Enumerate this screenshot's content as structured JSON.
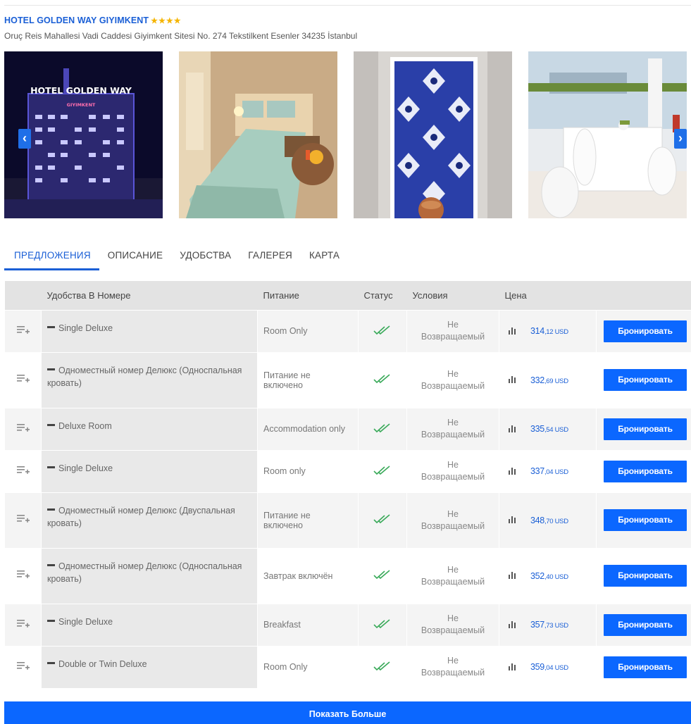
{
  "hotel": {
    "name": "HOTEL GOLDEN WAY GIYIMKENT",
    "stars": "★★★★",
    "address": "Oruç Reis Mahallesi Vadi Caddesi Giyimkent Sitesi No. 274 Tekstilkent Esenler 34235 İstanbul"
  },
  "gallery": {
    "sign_text": "HOTEL GOLDEN WAY",
    "sign_sub": "GIYIMKENT",
    "prev_arrow": "‹",
    "next_arrow": "›",
    "photos": [
      "hotel-exterior-night",
      "bedroom",
      "tile-panel",
      "banquet-hall"
    ]
  },
  "tabs": [
    "ПРЕДЛОЖЕНИЯ",
    "ОПИСАНИЕ",
    "УДОБСТВА",
    "ГАЛЕРЕЯ",
    "КАРТА"
  ],
  "table": {
    "headers": {
      "room": "Удобства В Номере",
      "meal": "Питание",
      "status": "Статус",
      "conditions": "Условия",
      "price": "Цена"
    },
    "rows": [
      {
        "room": "Single Deluxe",
        "meal": "Room Only",
        "cond1": "Не",
        "cond2": "Возвращаемый",
        "price_int": "314",
        "price_dec": ",12 USD",
        "book": "Бронировать"
      },
      {
        "room": "Одноместный номер Делюкс (Односпальная кровать)",
        "meal": "Питание не включено",
        "cond1": "Не",
        "cond2": "Возвращаемый",
        "price_int": "332",
        "price_dec": ",69 USD",
        "book": "Бронировать"
      },
      {
        "room": "Deluxe Room",
        "meal": "Accommodation only",
        "cond1": "Не",
        "cond2": "Возвращаемый",
        "price_int": "335",
        "price_dec": ",54 USD",
        "book": "Бронировать"
      },
      {
        "room": "Single Deluxe",
        "meal": "Room only",
        "cond1": "Не",
        "cond2": "Возвращаемый",
        "price_int": "337",
        "price_dec": ",04 USD",
        "book": "Бронировать"
      },
      {
        "room": "Одноместный номер Делюкс (Двуспальная кровать)",
        "meal": "Питание не включено",
        "cond1": "Не",
        "cond2": "Возвращаемый",
        "price_int": "348",
        "price_dec": ",70 USD",
        "book": "Бронировать"
      },
      {
        "room": "Одноместный номер Делюкс (Односпальная кровать)",
        "meal": "Завтрак включён",
        "cond1": "Не",
        "cond2": "Возвращаемый",
        "price_int": "352",
        "price_dec": ",40 USD",
        "book": "Бронировать"
      },
      {
        "room": "Single Deluxe",
        "meal": "Breakfast",
        "cond1": "Не",
        "cond2": "Возвращаемый",
        "price_int": "357",
        "price_dec": ",73 USD",
        "book": "Бронировать"
      },
      {
        "room": "Double or Twin Deluxe",
        "meal": "Room Only",
        "cond1": "Не",
        "cond2": "Возвращаемый",
        "price_int": "359",
        "price_dec": ",04 USD",
        "book": "Бронировать"
      }
    ]
  },
  "show_more": "Показать Больше",
  "colors": {
    "accent": "#0b67ff",
    "link": "#1a5fd6",
    "star": "#f5b500",
    "check": "#3aaa5a"
  }
}
